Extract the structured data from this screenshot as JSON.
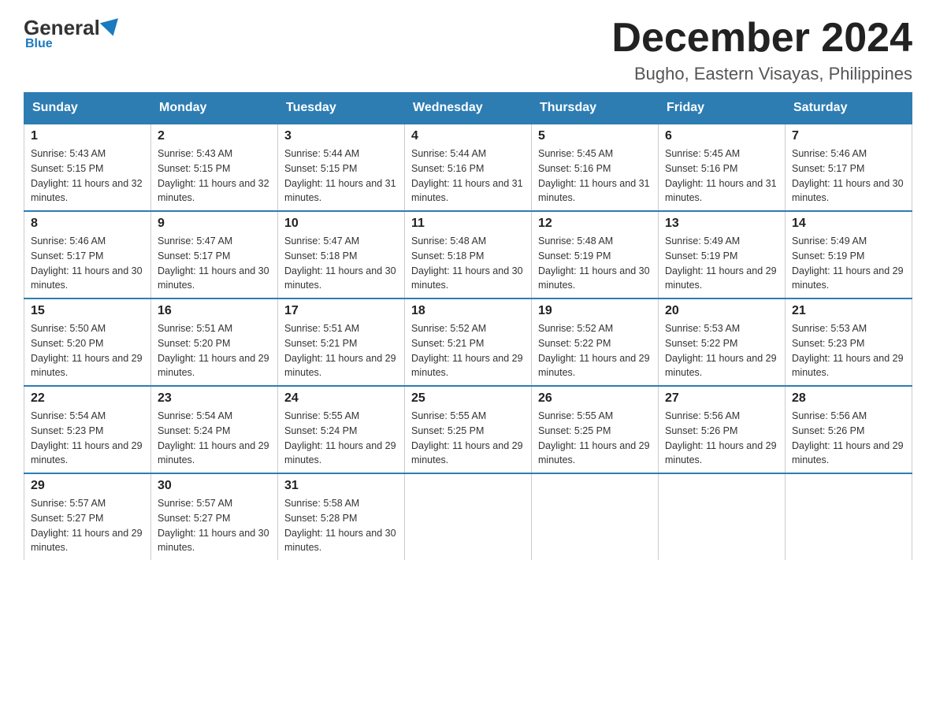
{
  "logo": {
    "general": "General",
    "blue": "Blue"
  },
  "header": {
    "title": "December 2024",
    "subtitle": "Bugho, Eastern Visayas, Philippines"
  },
  "weekdays": [
    "Sunday",
    "Monday",
    "Tuesday",
    "Wednesday",
    "Thursday",
    "Friday",
    "Saturday"
  ],
  "weeks": [
    [
      {
        "day": "1",
        "sunrise": "5:43 AM",
        "sunset": "5:15 PM",
        "daylight": "11 hours and 32 minutes."
      },
      {
        "day": "2",
        "sunrise": "5:43 AM",
        "sunset": "5:15 PM",
        "daylight": "11 hours and 32 minutes."
      },
      {
        "day": "3",
        "sunrise": "5:44 AM",
        "sunset": "5:15 PM",
        "daylight": "11 hours and 31 minutes."
      },
      {
        "day": "4",
        "sunrise": "5:44 AM",
        "sunset": "5:16 PM",
        "daylight": "11 hours and 31 minutes."
      },
      {
        "day": "5",
        "sunrise": "5:45 AM",
        "sunset": "5:16 PM",
        "daylight": "11 hours and 31 minutes."
      },
      {
        "day": "6",
        "sunrise": "5:45 AM",
        "sunset": "5:16 PM",
        "daylight": "11 hours and 31 minutes."
      },
      {
        "day": "7",
        "sunrise": "5:46 AM",
        "sunset": "5:17 PM",
        "daylight": "11 hours and 30 minutes."
      }
    ],
    [
      {
        "day": "8",
        "sunrise": "5:46 AM",
        "sunset": "5:17 PM",
        "daylight": "11 hours and 30 minutes."
      },
      {
        "day": "9",
        "sunrise": "5:47 AM",
        "sunset": "5:17 PM",
        "daylight": "11 hours and 30 minutes."
      },
      {
        "day": "10",
        "sunrise": "5:47 AM",
        "sunset": "5:18 PM",
        "daylight": "11 hours and 30 minutes."
      },
      {
        "day": "11",
        "sunrise": "5:48 AM",
        "sunset": "5:18 PM",
        "daylight": "11 hours and 30 minutes."
      },
      {
        "day": "12",
        "sunrise": "5:48 AM",
        "sunset": "5:19 PM",
        "daylight": "11 hours and 30 minutes."
      },
      {
        "day": "13",
        "sunrise": "5:49 AM",
        "sunset": "5:19 PM",
        "daylight": "11 hours and 29 minutes."
      },
      {
        "day": "14",
        "sunrise": "5:49 AM",
        "sunset": "5:19 PM",
        "daylight": "11 hours and 29 minutes."
      }
    ],
    [
      {
        "day": "15",
        "sunrise": "5:50 AM",
        "sunset": "5:20 PM",
        "daylight": "11 hours and 29 minutes."
      },
      {
        "day": "16",
        "sunrise": "5:51 AM",
        "sunset": "5:20 PM",
        "daylight": "11 hours and 29 minutes."
      },
      {
        "day": "17",
        "sunrise": "5:51 AM",
        "sunset": "5:21 PM",
        "daylight": "11 hours and 29 minutes."
      },
      {
        "day": "18",
        "sunrise": "5:52 AM",
        "sunset": "5:21 PM",
        "daylight": "11 hours and 29 minutes."
      },
      {
        "day": "19",
        "sunrise": "5:52 AM",
        "sunset": "5:22 PM",
        "daylight": "11 hours and 29 minutes."
      },
      {
        "day": "20",
        "sunrise": "5:53 AM",
        "sunset": "5:22 PM",
        "daylight": "11 hours and 29 minutes."
      },
      {
        "day": "21",
        "sunrise": "5:53 AM",
        "sunset": "5:23 PM",
        "daylight": "11 hours and 29 minutes."
      }
    ],
    [
      {
        "day": "22",
        "sunrise": "5:54 AM",
        "sunset": "5:23 PM",
        "daylight": "11 hours and 29 minutes."
      },
      {
        "day": "23",
        "sunrise": "5:54 AM",
        "sunset": "5:24 PM",
        "daylight": "11 hours and 29 minutes."
      },
      {
        "day": "24",
        "sunrise": "5:55 AM",
        "sunset": "5:24 PM",
        "daylight": "11 hours and 29 minutes."
      },
      {
        "day": "25",
        "sunrise": "5:55 AM",
        "sunset": "5:25 PM",
        "daylight": "11 hours and 29 minutes."
      },
      {
        "day": "26",
        "sunrise": "5:55 AM",
        "sunset": "5:25 PM",
        "daylight": "11 hours and 29 minutes."
      },
      {
        "day": "27",
        "sunrise": "5:56 AM",
        "sunset": "5:26 PM",
        "daylight": "11 hours and 29 minutes."
      },
      {
        "day": "28",
        "sunrise": "5:56 AM",
        "sunset": "5:26 PM",
        "daylight": "11 hours and 29 minutes."
      }
    ],
    [
      {
        "day": "29",
        "sunrise": "5:57 AM",
        "sunset": "5:27 PM",
        "daylight": "11 hours and 29 minutes."
      },
      {
        "day": "30",
        "sunrise": "5:57 AM",
        "sunset": "5:27 PM",
        "daylight": "11 hours and 30 minutes."
      },
      {
        "day": "31",
        "sunrise": "5:58 AM",
        "sunset": "5:28 PM",
        "daylight": "11 hours and 30 minutes."
      },
      null,
      null,
      null,
      null
    ]
  ]
}
